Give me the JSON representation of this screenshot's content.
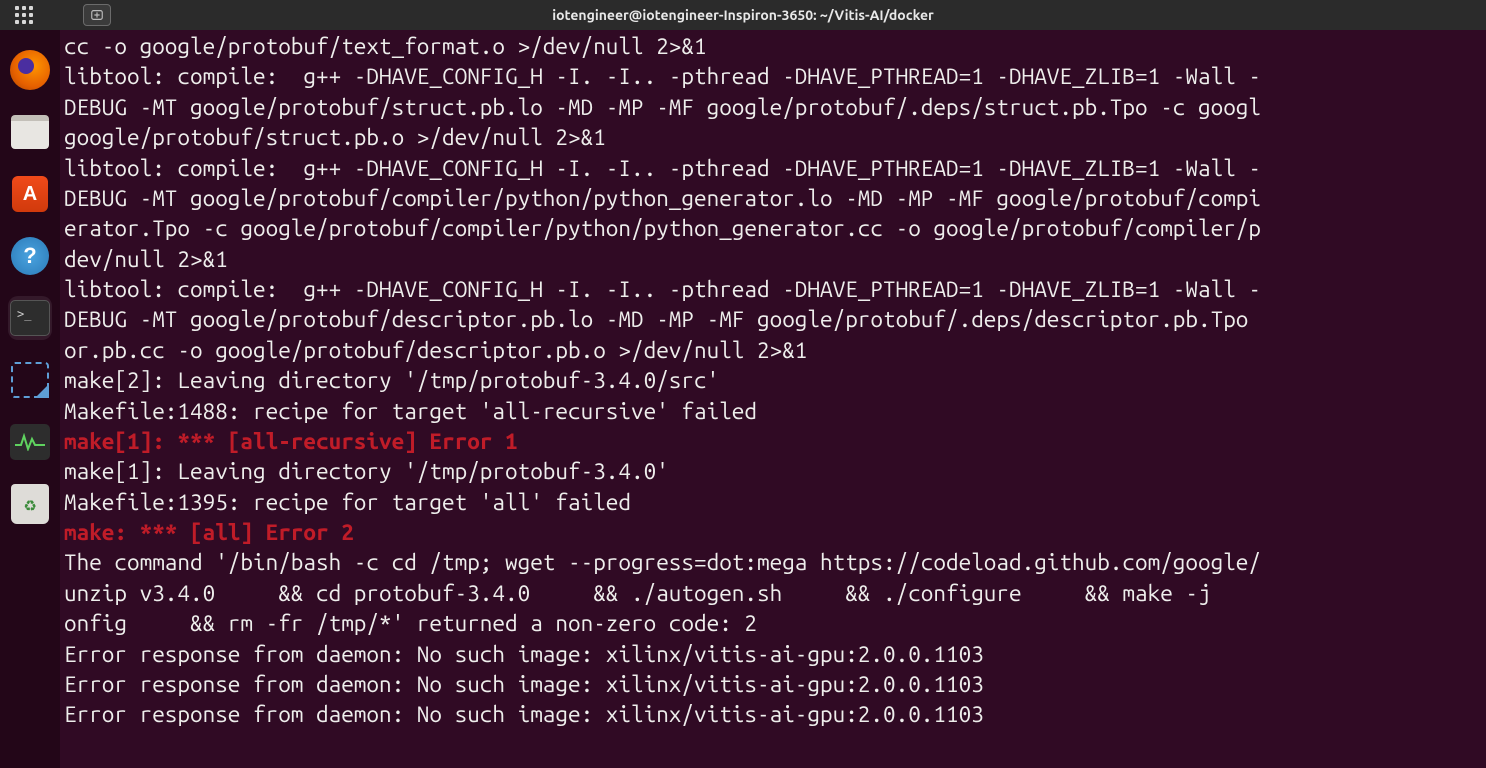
{
  "titlebar": {
    "title": "iotengineer@iotengineer-Inspiron-3650: ~/Vitis-AI/docker"
  },
  "dock": {
    "items": [
      {
        "name": "firefox",
        "label": "Firefox"
      },
      {
        "name": "files",
        "label": "Files"
      },
      {
        "name": "software",
        "label": "Ubuntu Software"
      },
      {
        "name": "help",
        "label": "Help",
        "glyph": "?"
      },
      {
        "name": "terminal",
        "label": "Terminal"
      },
      {
        "name": "screenshot",
        "label": "Screenshot"
      },
      {
        "name": "system-monitor",
        "label": "System Monitor"
      },
      {
        "name": "trash",
        "label": "Trash"
      }
    ]
  },
  "terminal": {
    "lines": [
      {
        "text": "cc -o google/protobuf/text_format.o >/dev/null 2>&1",
        "err": false
      },
      {
        "text": "libtool: compile:  g++ -DHAVE_CONFIG_H -I. -I.. -pthread -DHAVE_PTHREAD=1 -DHAVE_ZLIB=1 -Wall -",
        "err": false
      },
      {
        "text": "DEBUG -MT google/protobuf/struct.pb.lo -MD -MP -MF google/protobuf/.deps/struct.pb.Tpo -c googl",
        "err": false
      },
      {
        "text": "google/protobuf/struct.pb.o >/dev/null 2>&1",
        "err": false
      },
      {
        "text": "libtool: compile:  g++ -DHAVE_CONFIG_H -I. -I.. -pthread -DHAVE_PTHREAD=1 -DHAVE_ZLIB=1 -Wall -",
        "err": false
      },
      {
        "text": "DEBUG -MT google/protobuf/compiler/python/python_generator.lo -MD -MP -MF google/protobuf/compi",
        "err": false
      },
      {
        "text": "erator.Tpo -c google/protobuf/compiler/python/python_generator.cc -o google/protobuf/compiler/p",
        "err": false
      },
      {
        "text": "dev/null 2>&1",
        "err": false
      },
      {
        "text": "libtool: compile:  g++ -DHAVE_CONFIG_H -I. -I.. -pthread -DHAVE_PTHREAD=1 -DHAVE_ZLIB=1 -Wall -",
        "err": false
      },
      {
        "text": "DEBUG -MT google/protobuf/descriptor.pb.lo -MD -MP -MF google/protobuf/.deps/descriptor.pb.Tpo ",
        "err": false
      },
      {
        "text": "or.pb.cc -o google/protobuf/descriptor.pb.o >/dev/null 2>&1",
        "err": false
      },
      {
        "text": "make[2]: Leaving directory '/tmp/protobuf-3.4.0/src'",
        "err": false
      },
      {
        "text": "Makefile:1488: recipe for target 'all-recursive' failed",
        "err": false
      },
      {
        "text": "make[1]: *** [all-recursive] Error 1",
        "err": true
      },
      {
        "text": "make[1]: Leaving directory '/tmp/protobuf-3.4.0'",
        "err": false
      },
      {
        "text": "Makefile:1395: recipe for target 'all' failed",
        "err": false
      },
      {
        "text": "make: *** [all] Error 2",
        "err": true
      },
      {
        "text": "The command '/bin/bash -c cd /tmp; wget --progress=dot:mega https://codeload.github.com/google/",
        "err": false
      },
      {
        "text": "unzip v3.4.0     && cd protobuf-3.4.0     && ./autogen.sh     && ./configure     && make -j",
        "err": false
      },
      {
        "text": "onfig     && rm -fr /tmp/*' returned a non-zero code: 2",
        "err": false
      },
      {
        "text": "Error response from daemon: No such image: xilinx/vitis-ai-gpu:2.0.0.1103",
        "err": false
      },
      {
        "text": "Error response from daemon: No such image: xilinx/vitis-ai-gpu:2.0.0.1103",
        "err": false
      },
      {
        "text": "Error response from daemon: No such image: xilinx/vitis-ai-gpu:2.0.0.1103",
        "err": false
      }
    ]
  }
}
